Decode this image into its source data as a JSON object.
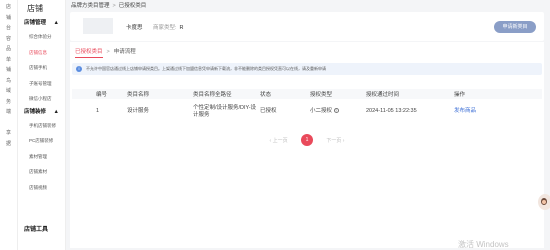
{
  "rail": {
    "items": [
      "店",
      "铺",
      "台",
      "容",
      "品",
      "单",
      "铺",
      "鸟",
      "域",
      "务",
      "端",
      "",
      "享",
      "据"
    ]
  },
  "menu": {
    "title": "店铺",
    "group1": {
      "label": "店铺管理",
      "arrow": "▲",
      "items": [
        "综合体验分",
        "店铺信息",
        "店铺手机",
        "子账号管理",
        "微信小程店"
      ]
    },
    "group2": {
      "label": "店铺装修",
      "arrow": "▲",
      "items": [
        "手机店铺装修",
        "PC店铺装修",
        "素材管理",
        "店铺素材",
        "店铺视频"
      ]
    },
    "bottom": "店铺工具",
    "active_index": 1
  },
  "breadcrumb": {
    "parent": "品牌方类目管理",
    "separator": ">",
    "current": "已授权类目"
  },
  "store": {
    "name": "卡度思",
    "type_label": "商家类型:",
    "type_value": "R",
    "apply_button": "申请新类目"
  },
  "tabs": {
    "active": "已授权类目",
    "separator": ">",
    "other": "申请流程"
  },
  "notice": {
    "icon": "info-icon",
    "text": "不允许中国官店通过线上店铺申请授类目。上架通过线下加盟信息凭申请新下载流，非不能删除的类目授权凭直可以在线，请及重新申请"
  },
  "table": {
    "headers": [
      "编号",
      "类目名称",
      "类目名称全路径",
      "状态",
      "授权类型",
      "授权通过时间",
      "操作"
    ],
    "rows": [
      {
        "id": "1",
        "name": "设计服务",
        "path": "个性定制/设计服务/DIY-设计服务",
        "status": "已授权",
        "auth_type": "小二授权",
        "auth_icon": "question-icon",
        "time": "2024-11-05 13:22:35",
        "action": "发布商品"
      }
    ]
  },
  "pager": {
    "prev": "‹ 上一页",
    "current": "1",
    "next": "下一页 ›"
  },
  "watermark": "激活 Windows",
  "colors": {
    "accent": "#e94a5b",
    "link": "#3d6fd6",
    "button": "#8a9ec7"
  }
}
